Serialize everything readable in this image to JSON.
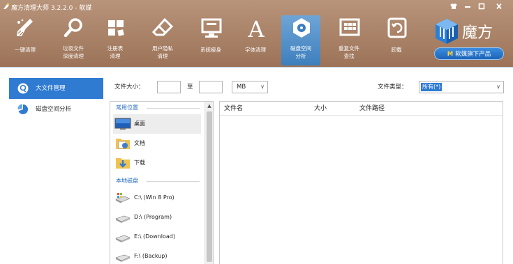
{
  "window": {
    "title": "魔方清理大师 3.2.2.0 - 软媒",
    "controls": [
      "skin-icon",
      "minimize-icon",
      "maximize-icon",
      "close-icon"
    ]
  },
  "toolbar": {
    "tools": [
      {
        "id": "one-click",
        "icon": "broom-icon",
        "label": "一键清理"
      },
      {
        "id": "junk",
        "icon": "magnifier-icon",
        "label": "垃圾文件\n深度清理"
      },
      {
        "id": "registry",
        "icon": "registry-cubes-icon",
        "label": "注册表\n清理"
      },
      {
        "id": "privacy",
        "icon": "eraser-icon",
        "label": "用户隐私\n清理"
      },
      {
        "id": "slim",
        "icon": "monitor-icon",
        "label": "系统瘦身"
      },
      {
        "id": "font",
        "icon": "font-a-icon",
        "label": "字体清理"
      },
      {
        "id": "disk",
        "icon": "disk-analysis-icon",
        "label": "磁盘空间\n分析",
        "active": true
      },
      {
        "id": "dup",
        "icon": "duplicate-files-icon",
        "label": "重复文件\n查找"
      },
      {
        "id": "uninstall",
        "icon": "recycle-bin-icon",
        "label": "卸载"
      }
    ],
    "brand": {
      "name": "魔方",
      "badge": "软媒旗下产品",
      "badge_letter": "M"
    }
  },
  "sidenav": {
    "items": [
      {
        "label": "大文件管理",
        "icon": "magnify-circle-icon",
        "selected": true
      },
      {
        "label": "磁盘空间分析",
        "icon": "pie-chart-icon",
        "selected": false
      }
    ]
  },
  "filter": {
    "size_label": "文件大小：",
    "min": "",
    "to_label": "至",
    "max": "",
    "unit": "MB",
    "type_label": "文件类型：",
    "type_value": "所有(*)"
  },
  "locations": {
    "common_title": "常用位置",
    "common": [
      {
        "label": "桌面",
        "icon": "desktop-icon",
        "selected": true
      },
      {
        "label": "文档",
        "icon": "documents-folder-icon"
      },
      {
        "label": "下载",
        "icon": "download-folder-icon"
      }
    ],
    "local_title": "本地磁盘",
    "drives": [
      {
        "label": "C:\\ (Win 8 Pro)",
        "icon": "system-drive-icon"
      },
      {
        "label": "D:\\ (Program)",
        "icon": "hard-drive-icon"
      },
      {
        "label": "E:\\ (Download)",
        "icon": "hard-drive-icon"
      },
      {
        "label": "F:\\ (Backup)",
        "icon": "hard-drive-icon"
      }
    ]
  },
  "filelist": {
    "columns": [
      "文件名",
      "大小",
      "文件路径"
    ]
  },
  "colors": {
    "top_bar": "#a7805f",
    "accent": "#2f7bd2",
    "section_title": "#2a6fc0"
  }
}
